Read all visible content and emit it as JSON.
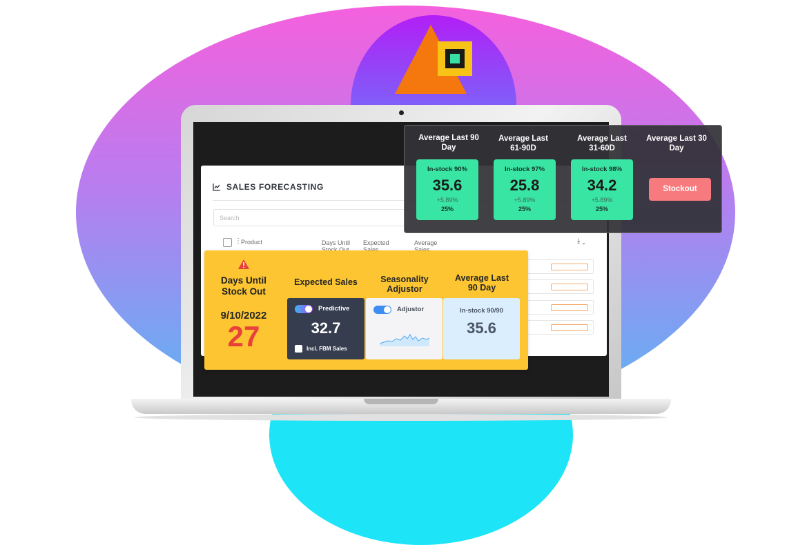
{
  "app": {
    "title": "SALES FORECASTING",
    "search_placeholder": "Search",
    "columns": {
      "product": "Product",
      "days_until": "Days Until Stock Out",
      "expected_sales": "Expected Sales",
      "average_sales": "Average Sales"
    }
  },
  "yellow_card": {
    "days_until_title": "Days Until Stock Out",
    "stockout_date": "9/10/2022",
    "days_count": "27",
    "expected_sales": {
      "heading": "Expected Sales",
      "toggle_label": "Predictive",
      "value": "32.7",
      "checkbox_label": "Incl. FBM Sales"
    },
    "seasonality": {
      "heading": "Seasonality Adjustor",
      "toggle_label": "Adjustor"
    },
    "average": {
      "heading": "Average Last 90 Day",
      "label": "In-stock 90/90",
      "value": "35.6"
    }
  },
  "dark_card": {
    "columns": [
      {
        "heading": "Average Last 90 Day",
        "label": "In-stock 90%",
        "value": "35.6",
        "change": "+5.89%",
        "pct": "25%"
      },
      {
        "heading": "Average Last 61-90D",
        "label": "In-stock 97%",
        "value": "25.8",
        "change": "+5.89%",
        "pct": "25%"
      },
      {
        "heading": "Average Last 31-60D",
        "label": "In-stock 98%",
        "value": "34.2",
        "change": "+5.89%",
        "pct": "25%"
      },
      {
        "heading": "Average Last 30 Day",
        "button": "Stockout"
      }
    ]
  },
  "colors": {
    "yellow": "#fcc531",
    "green": "#38e5a2",
    "alert_red": "#e8403a",
    "stockout_button": "#f77a7e",
    "logo_orange": "#f5780f"
  },
  "icons": [
    "chart-icon",
    "warning-icon",
    "download-icon",
    "kebab-icon",
    "chevron-down-icon",
    "sparkline-chart"
  ]
}
